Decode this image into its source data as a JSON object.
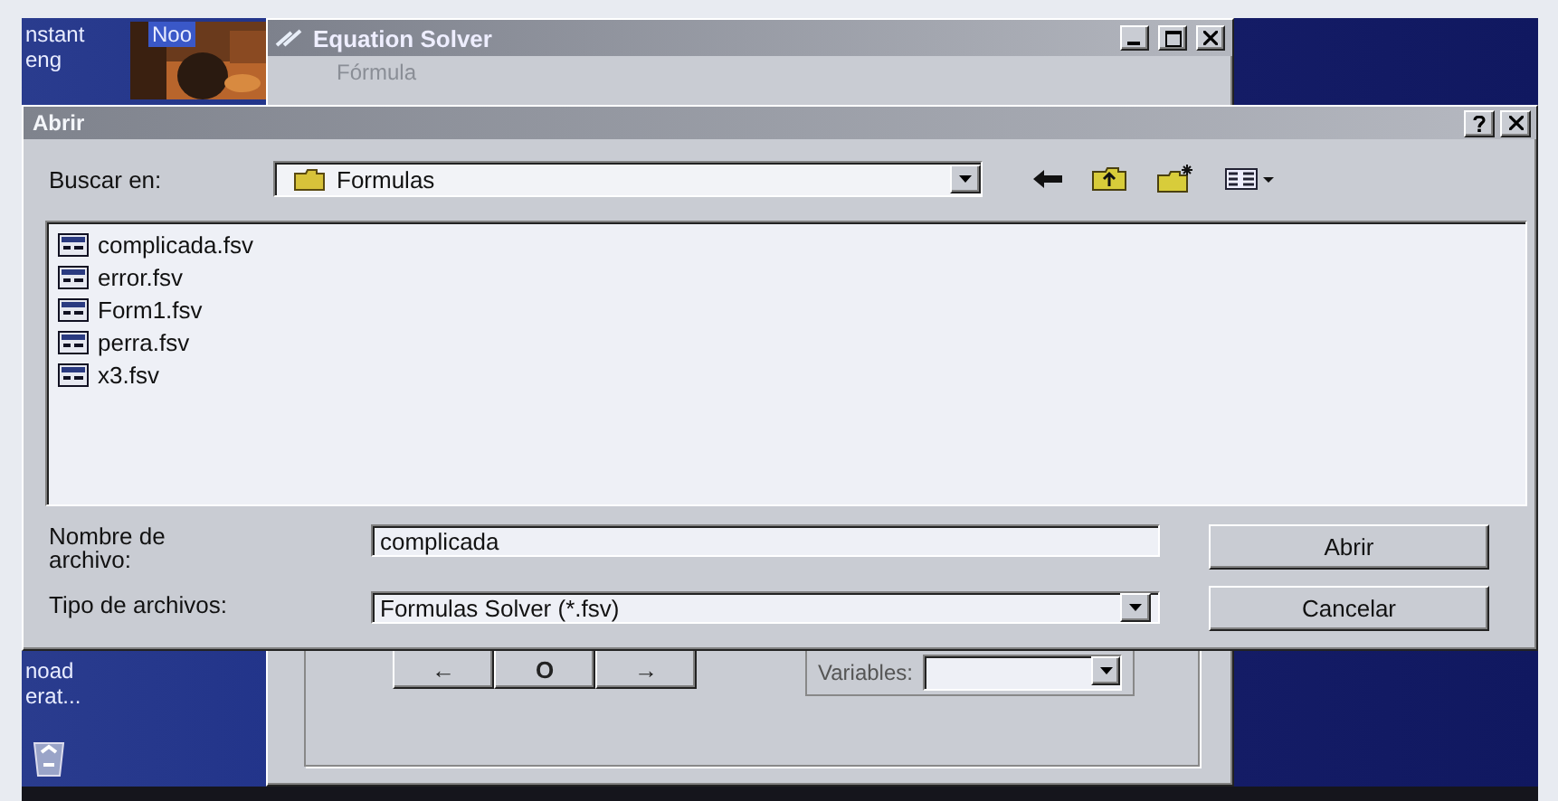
{
  "desktop": {
    "top_labels": [
      "nstant",
      "Noo",
      "eng"
    ],
    "bottom_labels": [
      "noad",
      "erat..."
    ]
  },
  "solver_window": {
    "title": "Equation Solver",
    "menu": [
      "Fórmula"
    ],
    "nav_buttons": [
      "←",
      "O",
      "→"
    ],
    "variables_label": "Variables:"
  },
  "dialog": {
    "title": "Abrir",
    "look_in": {
      "label": "Buscar en:",
      "value": "Formulas"
    },
    "files": [
      {
        "name": "complicada.fsv"
      },
      {
        "name": "error.fsv"
      },
      {
        "name": "Form1.fsv"
      },
      {
        "name": "perra.fsv"
      },
      {
        "name": "x3.fsv"
      }
    ],
    "file_name": {
      "label": "Nombre de archivo:",
      "value": "complicada"
    },
    "file_type": {
      "label": "Tipo de archivos:",
      "value": "Formulas Solver (*.fsv)"
    },
    "buttons": [
      "Abrir",
      "Cancelar"
    ]
  }
}
